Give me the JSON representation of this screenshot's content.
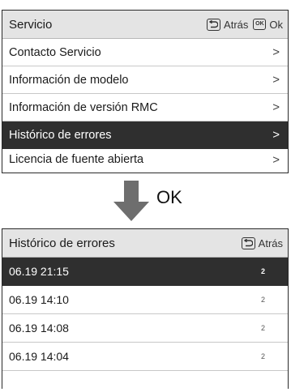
{
  "panel_top": {
    "title": "Servicio",
    "back_label": "Atrás",
    "ok_key": "OK",
    "ok_label": "Ok",
    "items": [
      {
        "label": "Contacto Servicio",
        "chevron": ">"
      },
      {
        "label": "Información de modelo",
        "chevron": ">"
      },
      {
        "label": "Información de versión RMC",
        "chevron": ">"
      },
      {
        "label": "Histórico de errores",
        "chevron": ">",
        "selected": true
      },
      {
        "label": "Licencia de fuente abierta",
        "chevron": ">"
      }
    ]
  },
  "transition": {
    "label": "OK"
  },
  "panel_bottom": {
    "title": "Histórico de errores",
    "back_label": "Atrás",
    "rows": [
      {
        "timestamp": "06.19 21:15",
        "count": "2",
        "selected": true
      },
      {
        "timestamp": "06.19 14:10",
        "count": "2"
      },
      {
        "timestamp": "06.19 14:08",
        "count": "2"
      },
      {
        "timestamp": "06.19 14:04",
        "count": "2"
      }
    ]
  },
  "colors": {
    "header_bg": "#e4e4e4",
    "selected_bg": "#2f2f2f",
    "arrow": "#6e6e6e"
  }
}
